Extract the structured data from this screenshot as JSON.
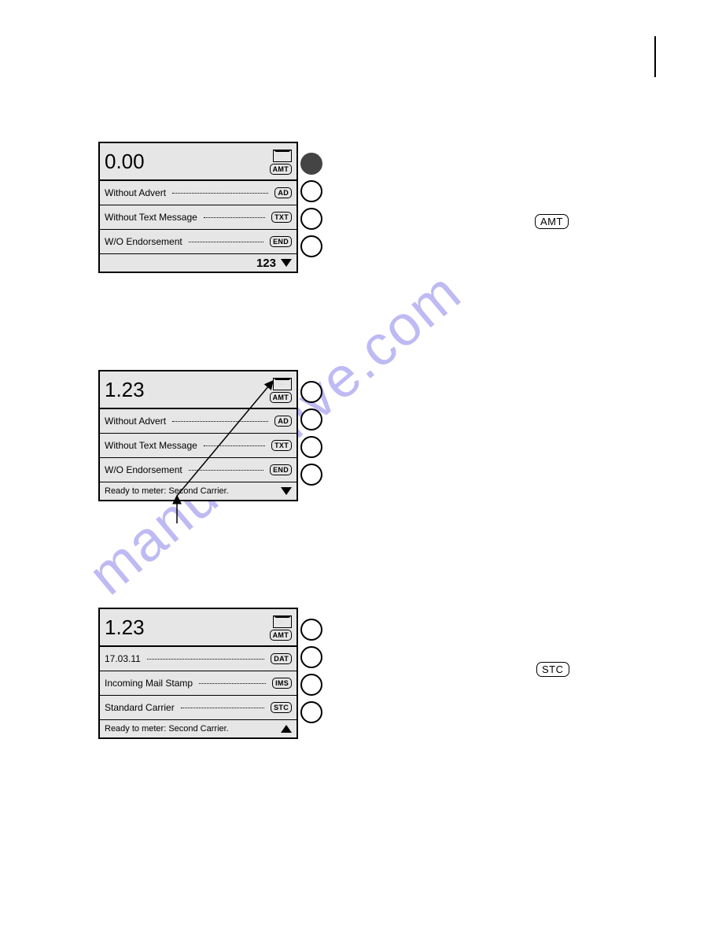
{
  "watermark": "manualshive.com",
  "keys": {
    "amt": "AMT",
    "stc": "STC"
  },
  "block1": {
    "amount": "0.00",
    "amtTag": "AMT",
    "rows": [
      {
        "label": "Without Advert",
        "tag": "AD"
      },
      {
        "label": "Without Text Message",
        "tag": "TXT"
      },
      {
        "label": "W/O Endorsement",
        "tag": "END"
      }
    ],
    "footerText": "123"
  },
  "block2": {
    "amount": "1.23",
    "amtTag": "AMT",
    "rows": [
      {
        "label": "Without Advert",
        "tag": "AD"
      },
      {
        "label": "Without Text Message",
        "tag": "TXT"
      },
      {
        "label": "W/O Endorsement",
        "tag": "END"
      }
    ],
    "statusText": "Ready to meter: Second Carrier."
  },
  "block3": {
    "amount": "1.23",
    "amtTag": "AMT",
    "rows": [
      {
        "label": "17.03.11",
        "tag": "DAT"
      },
      {
        "label": "Incoming Mail Stamp",
        "tag": "IMS"
      },
      {
        "label": "Standard Carrier",
        "tag": "STC"
      }
    ],
    "statusText": "Ready to meter: Second Carrier."
  }
}
